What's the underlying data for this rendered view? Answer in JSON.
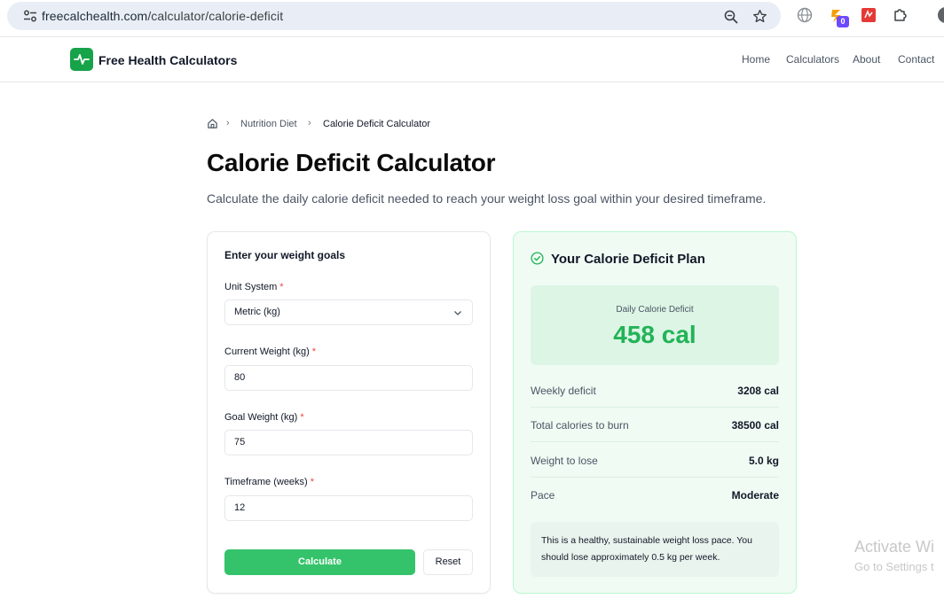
{
  "browser": {
    "url_domain": "freecalchealth.com",
    "url_path": "/calculator/calorie-deficit",
    "extension_badge": "0"
  },
  "header": {
    "brand": "Free Health Calculators",
    "nav": [
      "Home",
      "Calculators",
      "About",
      "Contact"
    ],
    "brand_color": "#16a34a"
  },
  "breadcrumb": {
    "items": [
      "Nutrition Diet",
      "Calorie Deficit Calculator"
    ]
  },
  "page": {
    "title": "Calorie Deficit Calculator",
    "subtitle": "Calculate the daily calorie deficit needed to reach your weight loss goal within your desired timeframe."
  },
  "form": {
    "heading": "Enter your weight goals",
    "required_mark": "*",
    "fields": [
      {
        "label": "Unit System",
        "value": "Metric (kg)",
        "type": "select"
      },
      {
        "label": "Current Weight (kg)",
        "value": "80",
        "type": "input"
      },
      {
        "label": "Goal Weight (kg)",
        "value": "75",
        "type": "input"
      },
      {
        "label": "Timeframe (weeks)",
        "value": "12",
        "type": "input"
      }
    ],
    "calculate_label": "Calculate",
    "reset_label": "Reset",
    "accent_color": "#34c36a"
  },
  "results": {
    "title": "Your Calorie Deficit Plan",
    "highlight_label": "Daily Calorie Deficit",
    "highlight_value": "458 cal",
    "rows": [
      {
        "label": "Weekly deficit",
        "value": "3208 cal"
      },
      {
        "label": "Total calories to burn",
        "value": "38500 cal"
      },
      {
        "label": "Weight to lose",
        "value": "5.0 kg"
      },
      {
        "label": "Pace",
        "value": "Moderate"
      }
    ],
    "note_line1": "This is a healthy, sustainable weight loss pace. You",
    "note_line2": "should lose approximately 0.5 kg per week."
  },
  "watermark": {
    "title": "Activate Wi",
    "subtitle": "Go to Settings t"
  }
}
